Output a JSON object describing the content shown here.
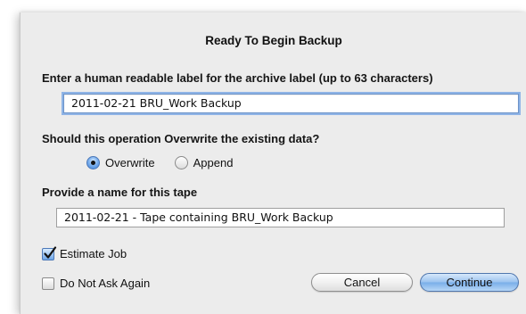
{
  "dialog": {
    "title": "Ready To Begin Backup",
    "archive_label_prompt": "Enter a human readable label for the archive label (up to 63 characters)",
    "archive_label_value": "2011-02-21 BRU_Work Backup",
    "overwrite_prompt": "Should this operation Overwrite the existing data?",
    "radio_overwrite": "Overwrite",
    "radio_append": "Append",
    "selected_mode": "Overwrite",
    "tape_name_prompt": "Provide a name for this tape",
    "tape_name_value": "2011-02-21  - Tape containing BRU_Work Backup",
    "estimate_job_label": "Estimate Job",
    "estimate_job_checked": true,
    "do_not_ask_label": "Do Not Ask Again",
    "do_not_ask_checked": false,
    "cancel_label": "Cancel",
    "continue_label": "Continue"
  }
}
